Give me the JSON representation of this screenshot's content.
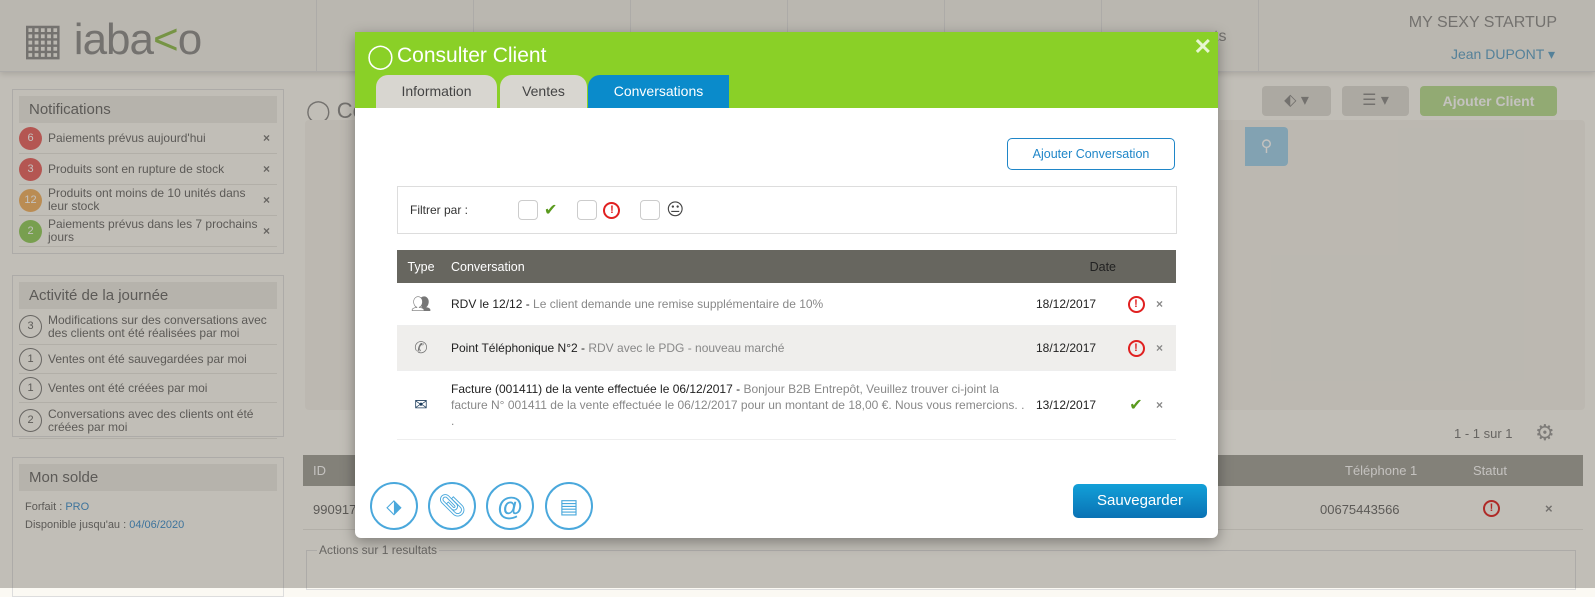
{
  "header": {
    "logo": "iabako",
    "company": "MY SEXY STARTUP",
    "user": "Jean DUPONT",
    "nav_last_fragment": "ts"
  },
  "notifications": {
    "title": "Notifications",
    "items": [
      {
        "count": "6",
        "text": "Paiements prévus aujourd'hui",
        "color": "#e8605f"
      },
      {
        "count": "3",
        "text": "Produits sont en rupture de stock",
        "color": "#e8605f"
      },
      {
        "count": "12",
        "text": "Produits ont moins de 10 unités dans leur stock",
        "color": "#f0b060"
      },
      {
        "count": "2",
        "text": "Paiements prévus dans les 7 prochains jours",
        "color": "#8fcc5a"
      }
    ]
  },
  "activity": {
    "title": "Activité de la journée",
    "items": [
      {
        "count": "3",
        "text": "Modifications sur des conversations avec des clients ont été réalisées par moi"
      },
      {
        "count": "1",
        "text": "Ventes ont été sauvegardées par moi"
      },
      {
        "count": "1",
        "text": "Ventes ont été créées par moi"
      },
      {
        "count": "2",
        "text": "Conversations avec des clients ont été créées par moi"
      }
    ]
  },
  "balance": {
    "title": "Mon solde",
    "plan_label": "Forfait : ",
    "plan": "PRO",
    "until_label": "Disponible jusqu'au : ",
    "until": "04/06/2020"
  },
  "main": {
    "title_fragment": "Co",
    "add_client": "Ajouter Client",
    "pagination": "1 - 1 sur 1",
    "table": {
      "headers": {
        "id": "ID",
        "phone": "Téléphone 1",
        "status": "Statut"
      },
      "row": {
        "id": "990917",
        "phone": "00675443566"
      }
    },
    "actions": "Actions sur 1 resultats"
  },
  "modal": {
    "title": "Consulter Client",
    "tabs": [
      "Information",
      "Ventes",
      "Conversations"
    ],
    "active_tab": "Conversations",
    "add_conversation": "Ajouter Conversation",
    "filter_label": "Filtrer par :",
    "table_headers": {
      "type": "Type",
      "conversation": "Conversation",
      "date": "Date"
    },
    "rows": [
      {
        "type": "meeting-icon",
        "title": "RDV le 12/12",
        "desc": "Le client demande une remise supplémentaire de 10%",
        "date": "18/12/2017",
        "status": "alert"
      },
      {
        "type": "phone-icon",
        "title": "Point Téléphonique N°2",
        "desc": "RDV avec le PDG - nouveau marché",
        "date": "18/12/2017",
        "status": "alert"
      },
      {
        "type": "email-icon",
        "title": "Facture (001411) de la vente effectuée le 06/12/2017",
        "desc": "Bonjour B2B Entrepôt, Veuillez trouver ci-joint la facture N° 001411 de la vente effectuée le 06/12/2017 pour un montant de 18,00 €. Nous vous remercions. . .",
        "date": "13/12/2017",
        "status": "ok"
      }
    ],
    "save": "Sauvegarder"
  },
  "colors": {
    "green": "#8ad027",
    "blue": "#0a8bcb",
    "alert": "#e02020",
    "ok": "#5a9a1e"
  }
}
